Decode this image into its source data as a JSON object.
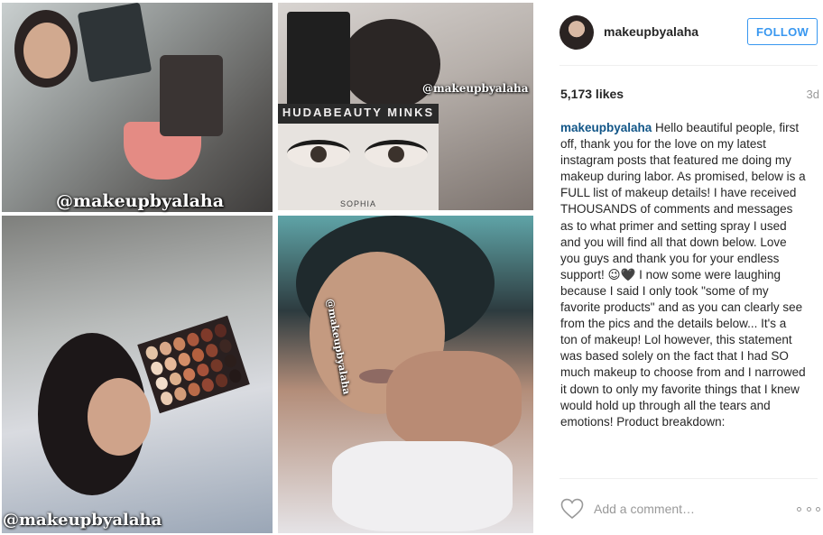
{
  "post": {
    "photo_watermarks": [
      "@makeupbyalaha",
      "@makeupbyalaha",
      "@makeupbyalaha",
      "@makeupbyalaha"
    ],
    "lash_card": {
      "brand": "HUDABEAUTY MINKS",
      "name": "SOPHIA"
    }
  },
  "header": {
    "username": "makeupbyalaha",
    "follow_label": "FOLLOW"
  },
  "stats": {
    "likes": "5,173 likes",
    "age": "3d"
  },
  "caption": {
    "username": "makeupbyalaha",
    "text": " Hello beautiful people, first off, thank you for the love on my latest instagram posts that featured me doing my makeup during labor. As promised, below is a FULL list of makeup details! I have received THOUSANDS of comments and messages as to what primer and setting spray I used and you will find all that down below. Love you guys and thank you for your endless support! 😉🖤 I now some were laughing because I said I only took \"some of my favorite products\" and as you can clearly see from the pics and the details below... It's a ton of makeup! Lol however, this statement was based solely on the fact that I had SO much makeup to choose from and I narrowed it down to only my favorite things that I knew would hold up through all the tears and emotions! Product breakdown:"
  },
  "comment": {
    "placeholder": "Add a comment…"
  },
  "icons": {
    "like": "heart-icon",
    "more": "more-options-icon"
  },
  "colors": {
    "accent": "#3897f0",
    "username": "#125688",
    "muted": "#999999"
  }
}
